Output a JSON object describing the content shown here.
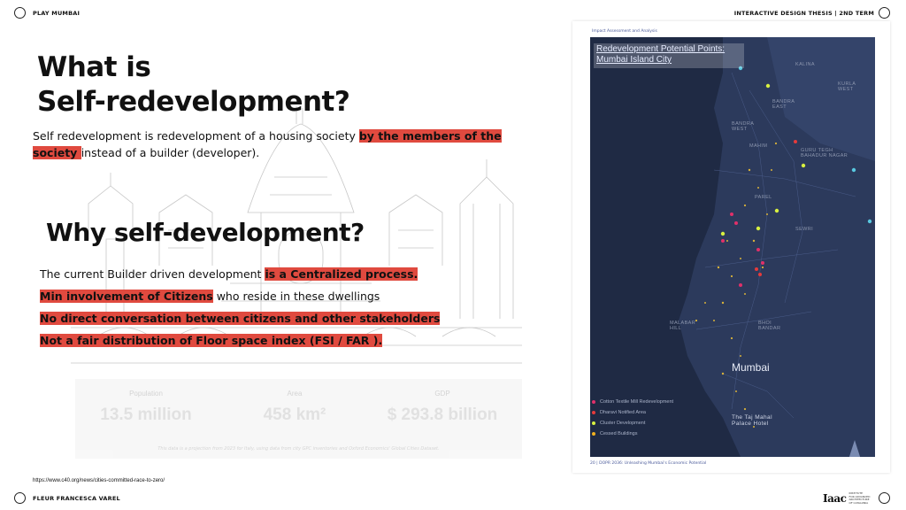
{
  "header": {
    "left_label": "PLAY MUMBAI",
    "right_label": "INTERACTIVE DESIGN THESIS | 2ND TERM"
  },
  "footer": {
    "author": "FLEUR FRANCESCA VAREL",
    "reference_url": "https://www.c40.org/news/cities-committed-race-to-zero/",
    "logo_mark": "Iaac",
    "logo_sub": [
      "INSTITUTE",
      "FOR ADVANCED",
      "ARCHITECTURE",
      "OF CATALONIA"
    ]
  },
  "section1": {
    "title_line1": "What is",
    "title_line2": "Self-redevelopment?",
    "text_before": "Self redevelopment is redevelopment of a housing society ",
    "text_highlight_1": "by the members of the",
    "text_highlight_2": "society ",
    "text_after": "instead of a builder (developer)."
  },
  "section2": {
    "title": "Why self-development?",
    "line1_plain": "The current Builder driven development ",
    "line1_highlight": "is a Centralized process.",
    "line2_highlight": "Min involvement of Citizens",
    "line2_plain": " who reside in these dwellings",
    "line3_highlight": "No direct conversation between citizens and other stakeholders",
    "line4_highlight": "Not a fair distribution of Floor space index (FSI / FAR )."
  },
  "stats": {
    "items": [
      {
        "label": "Population",
        "value": "13.5 million"
      },
      {
        "label": "Area",
        "value": "458 km²"
      },
      {
        "label": "GDP",
        "value": "$ 293.8 billion"
      }
    ],
    "note": "This data is a projection from 2023 for Italy, using data from city GPC inventories and Oxford Economics' Global Cities Dataset."
  },
  "map": {
    "header_text": "Impact Assessment and Analysis",
    "title_line1": "Redevelopment Potential Points:",
    "title_line2": "Mumbai Island City",
    "city_label": "Mumbai",
    "place_labels": [
      "KALINA",
      "KURLA WEST",
      "BANDRA EAST",
      "BANDRA WEST",
      "MAHIM",
      "GURU TEGH BAHADUR NAGAR",
      "SEWRI",
      "PAREL",
      "MALABAR HILL",
      "BHOI BANDAR",
      "The Taj Mahal Palace Hotel"
    ],
    "legend": [
      {
        "label": "Cotton Textile Mill Redevelopment",
        "color": "#e0306a"
      },
      {
        "label": "Dharavi Notified Area",
        "color": "#e63b3b"
      },
      {
        "label": "Cluster Development",
        "color": "#d8f040"
      },
      {
        "label": "Cessed Buildings",
        "color": "#f0b020"
      }
    ],
    "footer_text": "20 | DOPR 2036: Unleashing Mumbai's Economic Potential"
  }
}
